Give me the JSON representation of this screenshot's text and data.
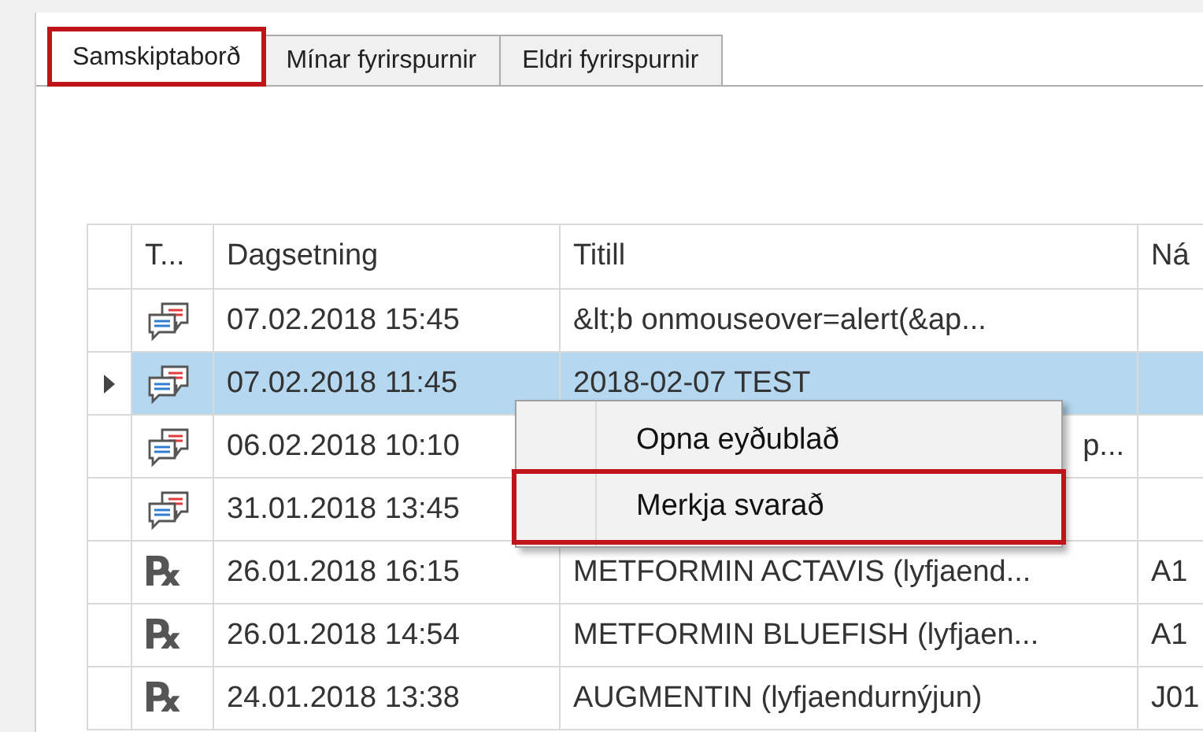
{
  "tabs": [
    {
      "label": "Samskiptaborð",
      "selected": true,
      "annotated": true
    },
    {
      "label": "Mínar fyrirspurnir",
      "selected": false,
      "annotated": false
    },
    {
      "label": "Eldri fyrirspurnir",
      "selected": false,
      "annotated": false
    }
  ],
  "table": {
    "columns": [
      "T...",
      "Dagsetning",
      "Titill",
      "Ná"
    ],
    "rows": [
      {
        "kind": "message",
        "date": "07.02.2018 15:45",
        "title": "&lt;b onmouseover=alert(&ap...",
        "column_4": "",
        "selected": false
      },
      {
        "kind": "message",
        "date": "07.02.2018 11:45",
        "title": "2018-02-07 TEST",
        "column_4": "",
        "selected": true
      },
      {
        "kind": "message",
        "date": "06.02.2018 10:10",
        "title": "p...",
        "column_4": "",
        "selected": false
      },
      {
        "kind": "message",
        "date": "31.01.2018 13:45",
        "title": "",
        "column_4": "",
        "selected": false
      },
      {
        "kind": "prescription",
        "symbol": "℞",
        "date": "26.01.2018 16:15",
        "title": "METFORMIN ACTAVIS (lyfjaend...",
        "column_4": "A1",
        "selected": false
      },
      {
        "kind": "prescription",
        "symbol": "℞",
        "date": "26.01.2018 14:54",
        "title": "METFORMIN BLUEFISH (lyfjaen...",
        "column_4": "A1",
        "selected": false
      },
      {
        "kind": "prescription",
        "symbol": "℞",
        "date": "24.01.2018 13:38",
        "title": "AUGMENTIN (lyfjaendurnýjun)",
        "column_4": "J01",
        "selected": false
      }
    ]
  },
  "context_menu": {
    "items": [
      {
        "label": "Opna eyðublað",
        "annotated": false
      },
      {
        "label": "Merkja svarað",
        "annotated": true
      }
    ]
  }
}
